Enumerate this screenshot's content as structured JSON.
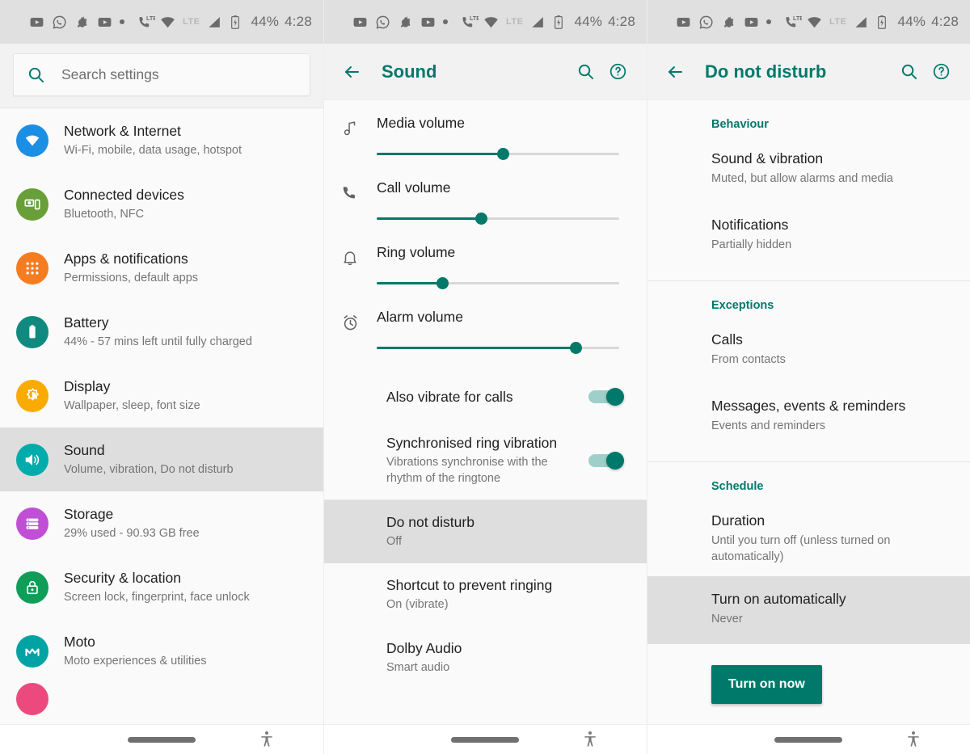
{
  "statusbar": {
    "icons": [
      "youtube-icon",
      "whatsapp-icon",
      "uc-browser-icon",
      "youtube-icon",
      "overflow-dot"
    ],
    "signal_icons": [
      "phone-lte-icon",
      "wifi-icon",
      "lte-label",
      "signal-bars-icon",
      "battery-charging-icon"
    ],
    "lte_label": "LTE",
    "battery": "44%",
    "time": "4:28"
  },
  "accent": "#00796b",
  "left_panel": {
    "search": {
      "placeholder": "Search settings",
      "icon": "search-icon"
    },
    "items": [
      {
        "title": "Network & Internet",
        "subtitle": "Wi-Fi, mobile, data usage, hotspot",
        "icon": "wifi-icon",
        "color": "#1a8fe3",
        "selected": false
      },
      {
        "title": "Connected devices",
        "subtitle": "Bluetooth, NFC",
        "icon": "devices-icon",
        "color": "#689f38",
        "selected": false
      },
      {
        "title": "Apps & notifications",
        "subtitle": "Permissions, default apps",
        "icon": "apps-grid-icon",
        "color": "#f57c20",
        "selected": false
      },
      {
        "title": "Battery",
        "subtitle": "44% - 57 mins left until fully charged",
        "icon": "battery-icon",
        "color": "#10897f",
        "selected": false
      },
      {
        "title": "Display",
        "subtitle": "Wallpaper, sleep, font size",
        "icon": "brightness-icon",
        "color": "#f9ab00",
        "selected": false
      },
      {
        "title": "Sound",
        "subtitle": "Volume, vibration, Do not disturb",
        "icon": "volume-icon",
        "color": "#00acab",
        "selected": true
      },
      {
        "title": "Storage",
        "subtitle": "29% used - 90.93 GB free",
        "icon": "storage-icon",
        "color": "#c14fd6",
        "selected": false
      },
      {
        "title": "Security & location",
        "subtitle": "Screen lock, fingerprint, face unlock",
        "icon": "lock-icon",
        "color": "#0f9d58",
        "selected": false
      },
      {
        "title": "Moto",
        "subtitle": "Moto experiences & utilities",
        "icon": "moto-icon",
        "color": "#00a3a3",
        "selected": false
      }
    ],
    "partial_item_color": "#ec4a7e"
  },
  "middle_panel": {
    "appbar": {
      "back": "back-arrow-icon",
      "title": "Sound",
      "search": "search-icon",
      "help": "help-icon"
    },
    "volumes": [
      {
        "label": "Media volume",
        "icon": "music-note-icon",
        "percent": 52
      },
      {
        "label": "Call volume",
        "icon": "phone-icon",
        "percent": 43
      },
      {
        "label": "Ring volume",
        "icon": "bell-icon",
        "percent": 27
      },
      {
        "label": "Alarm volume",
        "icon": "alarm-clock-icon",
        "percent": 82
      }
    ],
    "toggles": [
      {
        "title": "Also vibrate for calls",
        "subtitle": "",
        "on": true
      },
      {
        "title": "Synchronised ring vibration",
        "subtitle": "Vibrations synchronise with the rhythm of the ringtone",
        "on": true
      }
    ],
    "rows": [
      {
        "title": "Do not disturb",
        "subtitle": "Off",
        "selected": true
      },
      {
        "title": "Shortcut to prevent ringing",
        "subtitle": "On (vibrate)",
        "selected": false
      },
      {
        "title": "Dolby Audio",
        "subtitle": "Smart audio",
        "selected": false
      }
    ]
  },
  "right_panel": {
    "appbar": {
      "back": "back-arrow-icon",
      "title": "Do not disturb",
      "search": "search-icon",
      "help": "help-icon"
    },
    "sections": [
      {
        "header": "Behaviour",
        "rows": [
          {
            "title": "Sound & vibration",
            "subtitle": "Muted, but allow alarms and media",
            "selected": false
          },
          {
            "title": "Notifications",
            "subtitle": "Partially hidden",
            "selected": false
          }
        ]
      },
      {
        "header": "Exceptions",
        "rows": [
          {
            "title": "Calls",
            "subtitle": "From contacts",
            "selected": false
          },
          {
            "title": "Messages, events & reminders",
            "subtitle": "Events and reminders",
            "selected": false
          }
        ]
      },
      {
        "header": "Schedule",
        "rows": [
          {
            "title": "Duration",
            "subtitle": "Until you turn off (unless turned on automatically)",
            "selected": false
          },
          {
            "title": "Turn on automatically",
            "subtitle": "Never",
            "selected": true
          }
        ]
      }
    ],
    "button_label": "Turn on now"
  },
  "bottom_nav": {
    "pill": "home-pill",
    "a11y": "accessibility-icon"
  }
}
